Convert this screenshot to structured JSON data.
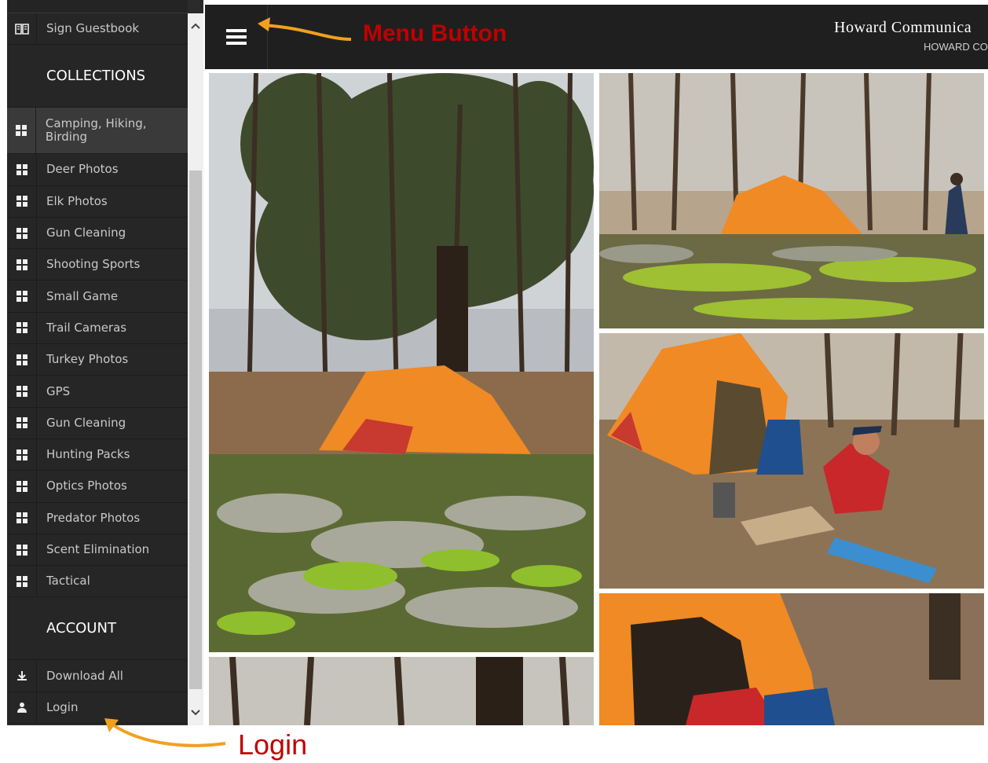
{
  "sidebar": {
    "guestbook": {
      "label": "Sign Guestbook",
      "icon": "book-icon"
    },
    "collections_heading": "COLLECTIONS",
    "collections": [
      {
        "label": "Camping, Hiking, Birding",
        "icon": "grid-icon"
      },
      {
        "label": "Deer Photos",
        "icon": "grid-icon"
      },
      {
        "label": "Elk Photos",
        "icon": "grid-icon"
      },
      {
        "label": "Gun Cleaning",
        "icon": "grid-icon"
      },
      {
        "label": "Shooting Sports",
        "icon": "grid-icon"
      },
      {
        "label": "Small Game",
        "icon": "grid-icon"
      },
      {
        "label": "Trail Cameras",
        "icon": "grid-icon"
      },
      {
        "label": "Turkey Photos",
        "icon": "grid-icon"
      },
      {
        "label": "GPS",
        "icon": "grid-icon"
      },
      {
        "label": "Gun Cleaning",
        "icon": "grid-icon"
      },
      {
        "label": "Hunting Packs",
        "icon": "grid-icon"
      },
      {
        "label": "Optics Photos",
        "icon": "grid-icon"
      },
      {
        "label": "Predator Photos",
        "icon": "grid-icon"
      },
      {
        "label": "Scent Elimination",
        "icon": "grid-icon"
      },
      {
        "label": "Tactical",
        "icon": "grid-icon"
      }
    ],
    "account_heading": "ACCOUNT",
    "account": [
      {
        "label": "Download All",
        "icon": "download-icon"
      },
      {
        "label": "Login",
        "icon": "user-icon"
      }
    ]
  },
  "header": {
    "title": "Howard Communica",
    "subtitle": "HOWARD CO"
  },
  "annotations": {
    "menu": "Menu Button",
    "login": "Login"
  },
  "colors": {
    "sidebar_bg": "#262626",
    "topbar_bg": "#1f1f1f",
    "annotation_text": "#c00000",
    "annotation_arrow": "#f0a020",
    "tent_orange": "#f08a24"
  }
}
